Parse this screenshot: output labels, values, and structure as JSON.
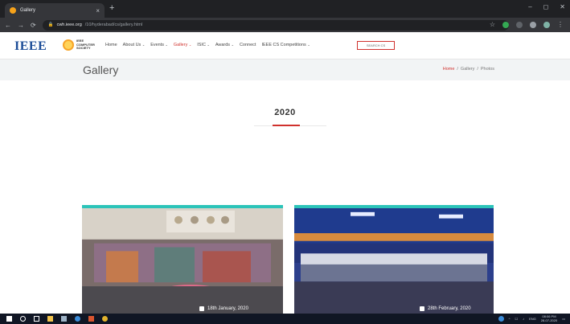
{
  "browser": {
    "tab_title": "Gallery",
    "tab_close": "×",
    "new_tab": "+",
    "window_controls": [
      "–",
      "◻",
      "✕"
    ],
    "url_host": "cwh.ieee.org",
    "url_path": "/10/hyderabad/cs/gallery.html"
  },
  "site": {
    "ieee_logo": "IEEE",
    "cs_logo_lines": [
      "IEEE",
      "COMPUTER",
      "SOCIETY"
    ],
    "nav": [
      {
        "label": "Home",
        "caret": ""
      },
      {
        "label": "About Us",
        "caret": "⌄"
      },
      {
        "label": "Events",
        "caret": "⌄"
      },
      {
        "label": "Gallery",
        "caret": "⌄"
      },
      {
        "label": "ISIC",
        "caret": "⌄"
      },
      {
        "label": "Awards",
        "caret": "⌄"
      },
      {
        "label": "Connect",
        "caret": ""
      },
      {
        "label": "IEEE CS Competitions",
        "caret": "⌄"
      }
    ],
    "search_placeholder": "SEARCH CS"
  },
  "page": {
    "title": "Gallery",
    "breadcrumb": {
      "home": "Home",
      "sep": "/",
      "section": "Gallery",
      "current": "Photos"
    },
    "year": "2020"
  },
  "cards": [
    {
      "caption": "18th January, 2020"
    },
    {
      "caption": "28th February, 2020"
    }
  ],
  "taskbar": {
    "lang": "ENG",
    "time": "08:06 PM",
    "date": "28-07-2020"
  },
  "colors": {
    "accent": "#d0312d",
    "card_border": "#2cc4b9",
    "ieee_blue": "#1b4c97"
  }
}
